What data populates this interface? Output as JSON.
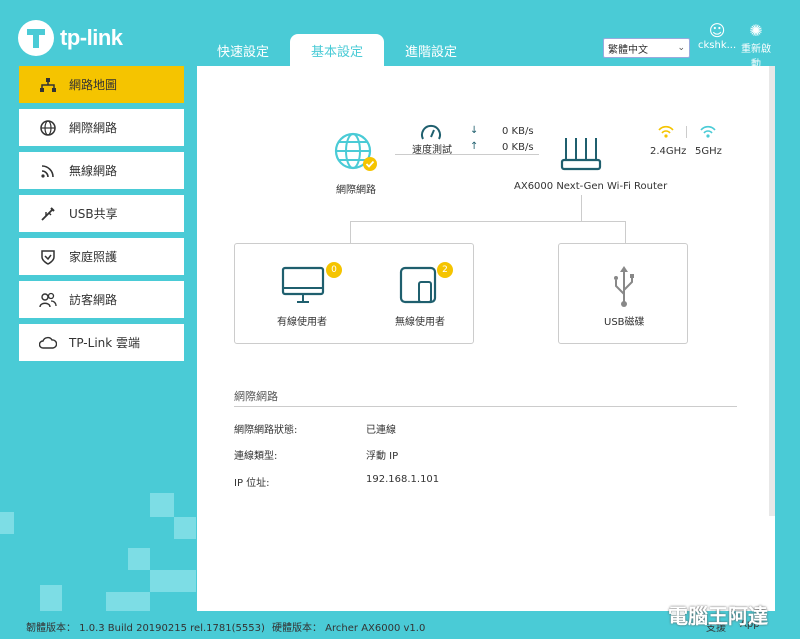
{
  "brand": {
    "logo_text": "tp-link"
  },
  "tabs": [
    {
      "label": "快速設定"
    },
    {
      "label": "基本設定"
    },
    {
      "label": "進階設定"
    }
  ],
  "header": {
    "language": "繁體中文",
    "user": "ckshk...",
    "reboot": "重新啟動"
  },
  "sidebar": {
    "items": [
      {
        "label": "網路地圖",
        "icon": "network-map-icon"
      },
      {
        "label": "網際網路",
        "icon": "globe-icon"
      },
      {
        "label": "無線網路",
        "icon": "wifi-icon"
      },
      {
        "label": "USB共享",
        "icon": "usb-icon"
      },
      {
        "label": "家庭照護",
        "icon": "shield-icon"
      },
      {
        "label": "訪客網路",
        "icon": "guests-icon"
      },
      {
        "label": "TP-Link 雲端",
        "icon": "cloud-icon"
      }
    ]
  },
  "map": {
    "internet_label": "網際網路",
    "speed_test": "速度測試",
    "download": "0 KB/s",
    "upload": "0 KB/s",
    "router_name": "AX6000 Next-Gen Wi-Fi Router",
    "band_24": "2.4GHz",
    "band_5": "5GHz",
    "wired_label": "有線使用者",
    "wired_count": "0",
    "wireless_label": "無線使用者",
    "wireless_count": "2",
    "usb_label": "USB磁碟"
  },
  "info": {
    "title": "網際網路",
    "rows": [
      {
        "key": "網際網路狀態:",
        "value": "已連線"
      },
      {
        "key": "連線類型:",
        "value": "浮動 IP"
      },
      {
        "key": "IP 位址:",
        "value": "192.168.1.101"
      }
    ]
  },
  "footer": {
    "firmware": "韌體版本： 1.0.3 Build 20190215 rel.1781(5553)",
    "hardware": "硬體版本： Archer AX6000 v1.0",
    "support": "支援",
    "app": "App",
    "watermark": "電腦王阿達"
  },
  "colors": {
    "accent": "#4acbd6",
    "active": "#f5c400",
    "teal_dark": "#1f5f6e"
  }
}
